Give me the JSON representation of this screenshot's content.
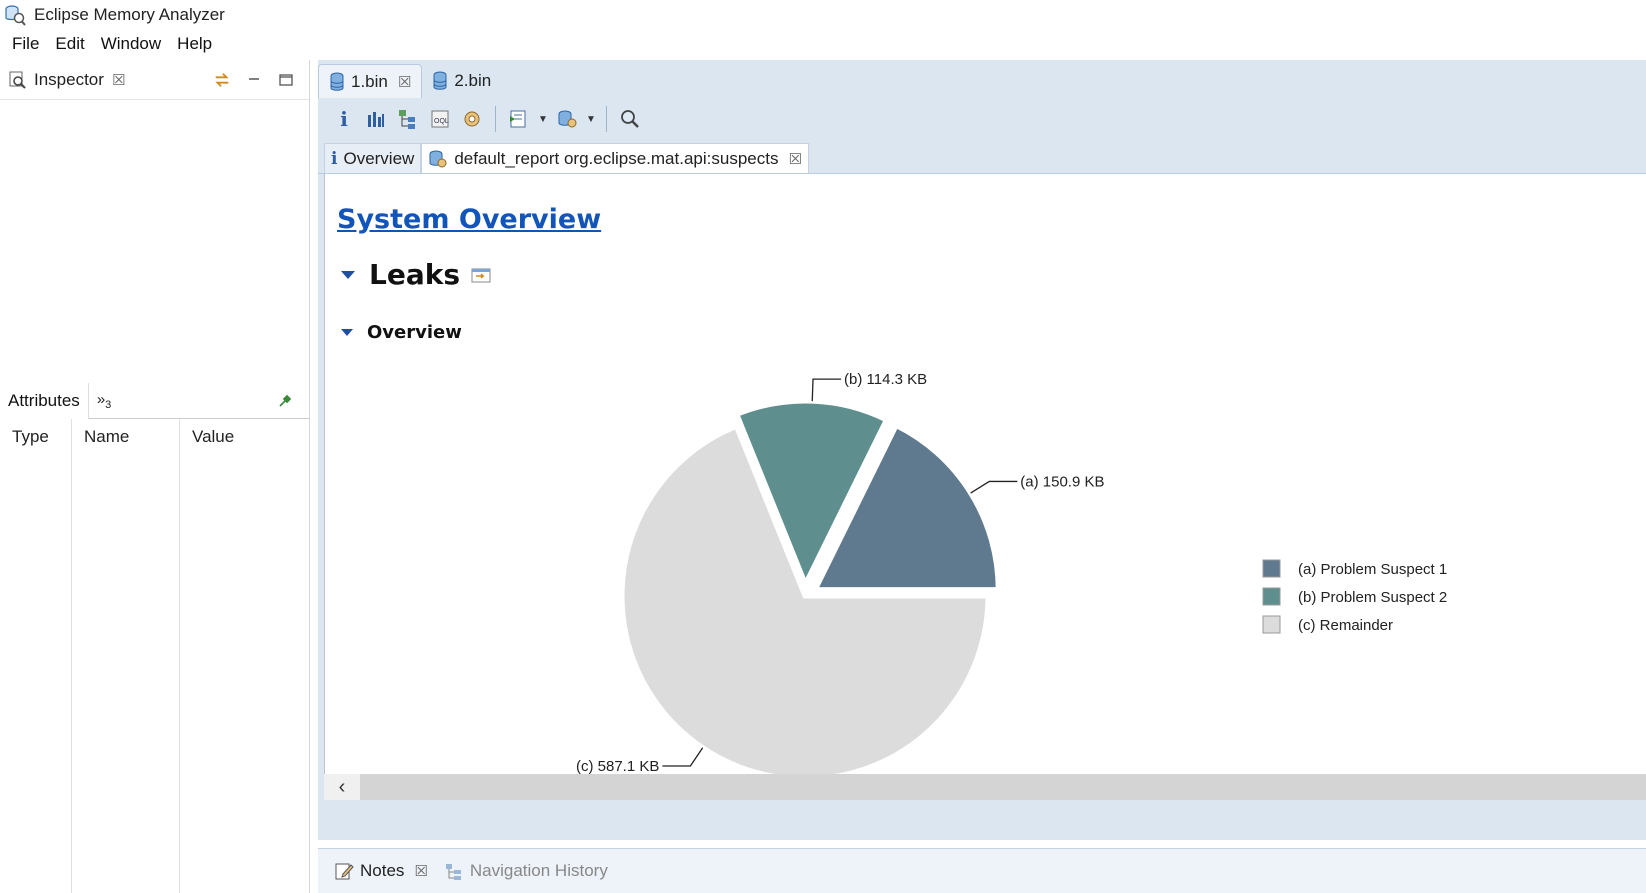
{
  "window": {
    "title": "Eclipse Memory Analyzer"
  },
  "menu": [
    "File",
    "Edit",
    "Window",
    "Help"
  ],
  "inspector": {
    "tab_label": "Inspector",
    "close": "☒"
  },
  "attributes": {
    "tab_label": "Attributes",
    "more_label": "»",
    "more_count": "3",
    "columns": [
      "Type",
      "Name",
      "Value"
    ]
  },
  "editor_tabs": [
    {
      "label": "1.bin",
      "close": "☒"
    },
    {
      "label": "2.bin"
    }
  ],
  "inner_tabs": {
    "overview": {
      "icon_text": "i",
      "label": "Overview"
    },
    "report": {
      "label": "default_report  org.eclipse.mat.api:suspects",
      "close": "☒"
    }
  },
  "content": {
    "heading": "System Overview",
    "section": "Leaks",
    "subsection": "Overview"
  },
  "chart_data": {
    "type": "pie",
    "slices": [
      {
        "label": "(a)",
        "value_text": "150.9 KB",
        "value_kb": 150.9,
        "name": "Problem Suspect 1",
        "color": "#5f7a8e"
      },
      {
        "label": "(b)",
        "value_text": "114.3 KB",
        "value_kb": 114.3,
        "name": "Problem Suspect 2",
        "color": "#5e8e8e"
      },
      {
        "label": "(c)",
        "value_text": "587.1 KB",
        "value_kb": 587.1,
        "name": "Remainder",
        "color": "#dcdcdc"
      }
    ],
    "legend_placement": "right"
  },
  "bottom_tabs": {
    "notes": {
      "label": "Notes",
      "close": "☒"
    },
    "nav_history": {
      "label": "Navigation History"
    }
  },
  "colors": {
    "accent": "#1155bb",
    "editor_bg": "#dbe6f1"
  }
}
